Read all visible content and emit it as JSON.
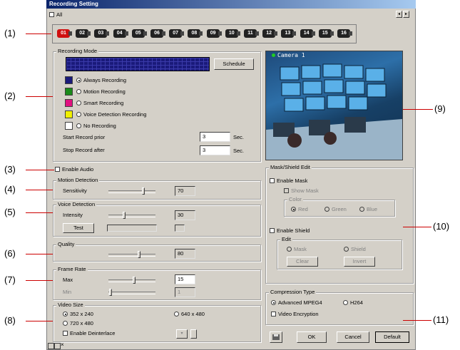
{
  "window": {
    "title": "Recording Setting"
  },
  "top": {
    "all_label": "All",
    "cameras": [
      "01",
      "02",
      "03",
      "04",
      "05",
      "06",
      "07",
      "08",
      "09",
      "10",
      "11",
      "12",
      "13",
      "14",
      "15",
      "16"
    ],
    "selected_index": 0
  },
  "callouts": [
    "(1)",
    "(2)",
    "(3)",
    "(4)",
    "(5)",
    "(6)",
    "(7)",
    "(8)",
    "(9)",
    "(10)",
    "(11)"
  ],
  "recording_mode": {
    "group_label": "Recording Mode",
    "schedule_label": "Schedule",
    "modes": [
      {
        "label": "Always Recording",
        "color": "#1a1a7a",
        "selected": true
      },
      {
        "label": "Motion Recording",
        "color": "#1a8a1a",
        "selected": false
      },
      {
        "label": "Smart Recording",
        "color": "#e01080",
        "selected": false
      },
      {
        "label": "Voice Detection Recording",
        "color": "#f0f000",
        "selected": false
      },
      {
        "label": "No Recording",
        "color": "#ffffff",
        "selected": false
      }
    ],
    "start_label": "Start Record prior",
    "start_value": "3",
    "start_unit": "Sec.",
    "stop_label": "Stop Record after",
    "stop_value": "3",
    "stop_unit": "Sec."
  },
  "preview": {
    "camera_label": "Camera 1"
  },
  "enable_audio_label": "Enable Audio",
  "motion_detection": {
    "group_label": "Motion Detection",
    "sensitivity_label": "Sensitivity",
    "value": "70"
  },
  "voice_detection": {
    "group_label": "Voice Detection",
    "intensity_label": "Intensity",
    "value": "30",
    "test_label": "Test"
  },
  "quality": {
    "group_label": "Quality",
    "value": "80"
  },
  "frame_rate": {
    "group_label": "Frame Rate",
    "max_label": "Max",
    "max_value": "15",
    "min_label": "Min",
    "min_value": "1"
  },
  "video_size": {
    "group_label": "Video Size",
    "options": [
      "352 x 240",
      "640 x 480",
      "720 x 480"
    ],
    "selected": "352 x 240",
    "deinterlace_label": "Enable Deinterlace"
  },
  "mask": {
    "group_label": "Mask/Shield Edit",
    "enable_mask_label": "Enable Mask",
    "show_mask_label": "Show Mask",
    "color_label": "Color",
    "colors": [
      "Red",
      "Green",
      "Blue"
    ],
    "enable_shield_label": "Enable Shield",
    "edit_label": "Edit",
    "edit_options": [
      "Mask",
      "Shield"
    ],
    "clear_label": "Clear",
    "invert_label": "Invert"
  },
  "compression": {
    "group_label": "Compression Type",
    "options": [
      "Advanced MPEG4",
      "H264"
    ],
    "selected": "Advanced MPEG4",
    "encryption_label": "Video Encryption"
  },
  "buttons": {
    "ok": "OK",
    "cancel": "Cancel",
    "default": "Default"
  }
}
